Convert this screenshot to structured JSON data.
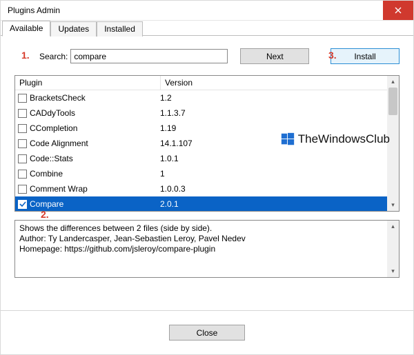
{
  "title": "Plugins Admin",
  "tabs": {
    "available": "Available",
    "updates": "Updates",
    "installed": "Installed"
  },
  "annotations": {
    "one": "1.",
    "two": "2.",
    "three": "3."
  },
  "search": {
    "label": "Search:",
    "value": "compare",
    "next_label": "Next",
    "install_label": "Install"
  },
  "columns": {
    "plugin": "Plugin",
    "version": "Version"
  },
  "plugins": [
    {
      "name": "BracketsCheck",
      "version": "1.2",
      "checked": false,
      "selected": false
    },
    {
      "name": "CADdyTools",
      "version": "1.1.3.7",
      "checked": false,
      "selected": false
    },
    {
      "name": "CCompletion",
      "version": "1.19",
      "checked": false,
      "selected": false
    },
    {
      "name": "Code Alignment",
      "version": "14.1.107",
      "checked": false,
      "selected": false
    },
    {
      "name": "Code::Stats",
      "version": "1.0.1",
      "checked": false,
      "selected": false
    },
    {
      "name": "Combine",
      "version": "1",
      "checked": false,
      "selected": false
    },
    {
      "name": "Comment Wrap",
      "version": "1.0.0.3",
      "checked": false,
      "selected": false
    },
    {
      "name": "Compare",
      "version": "2.0.1",
      "checked": true,
      "selected": true
    }
  ],
  "description": {
    "line1": "Shows the differences between 2 files (side by side).",
    "line2": "Author: Ty Landercasper, Jean-Sebastien Leroy, Pavel Nedev",
    "line3": "Homepage: https://github.com/jsleroy/compare-plugin"
  },
  "footer": {
    "close_label": "Close"
  },
  "watermark": "TheWindowsClub"
}
